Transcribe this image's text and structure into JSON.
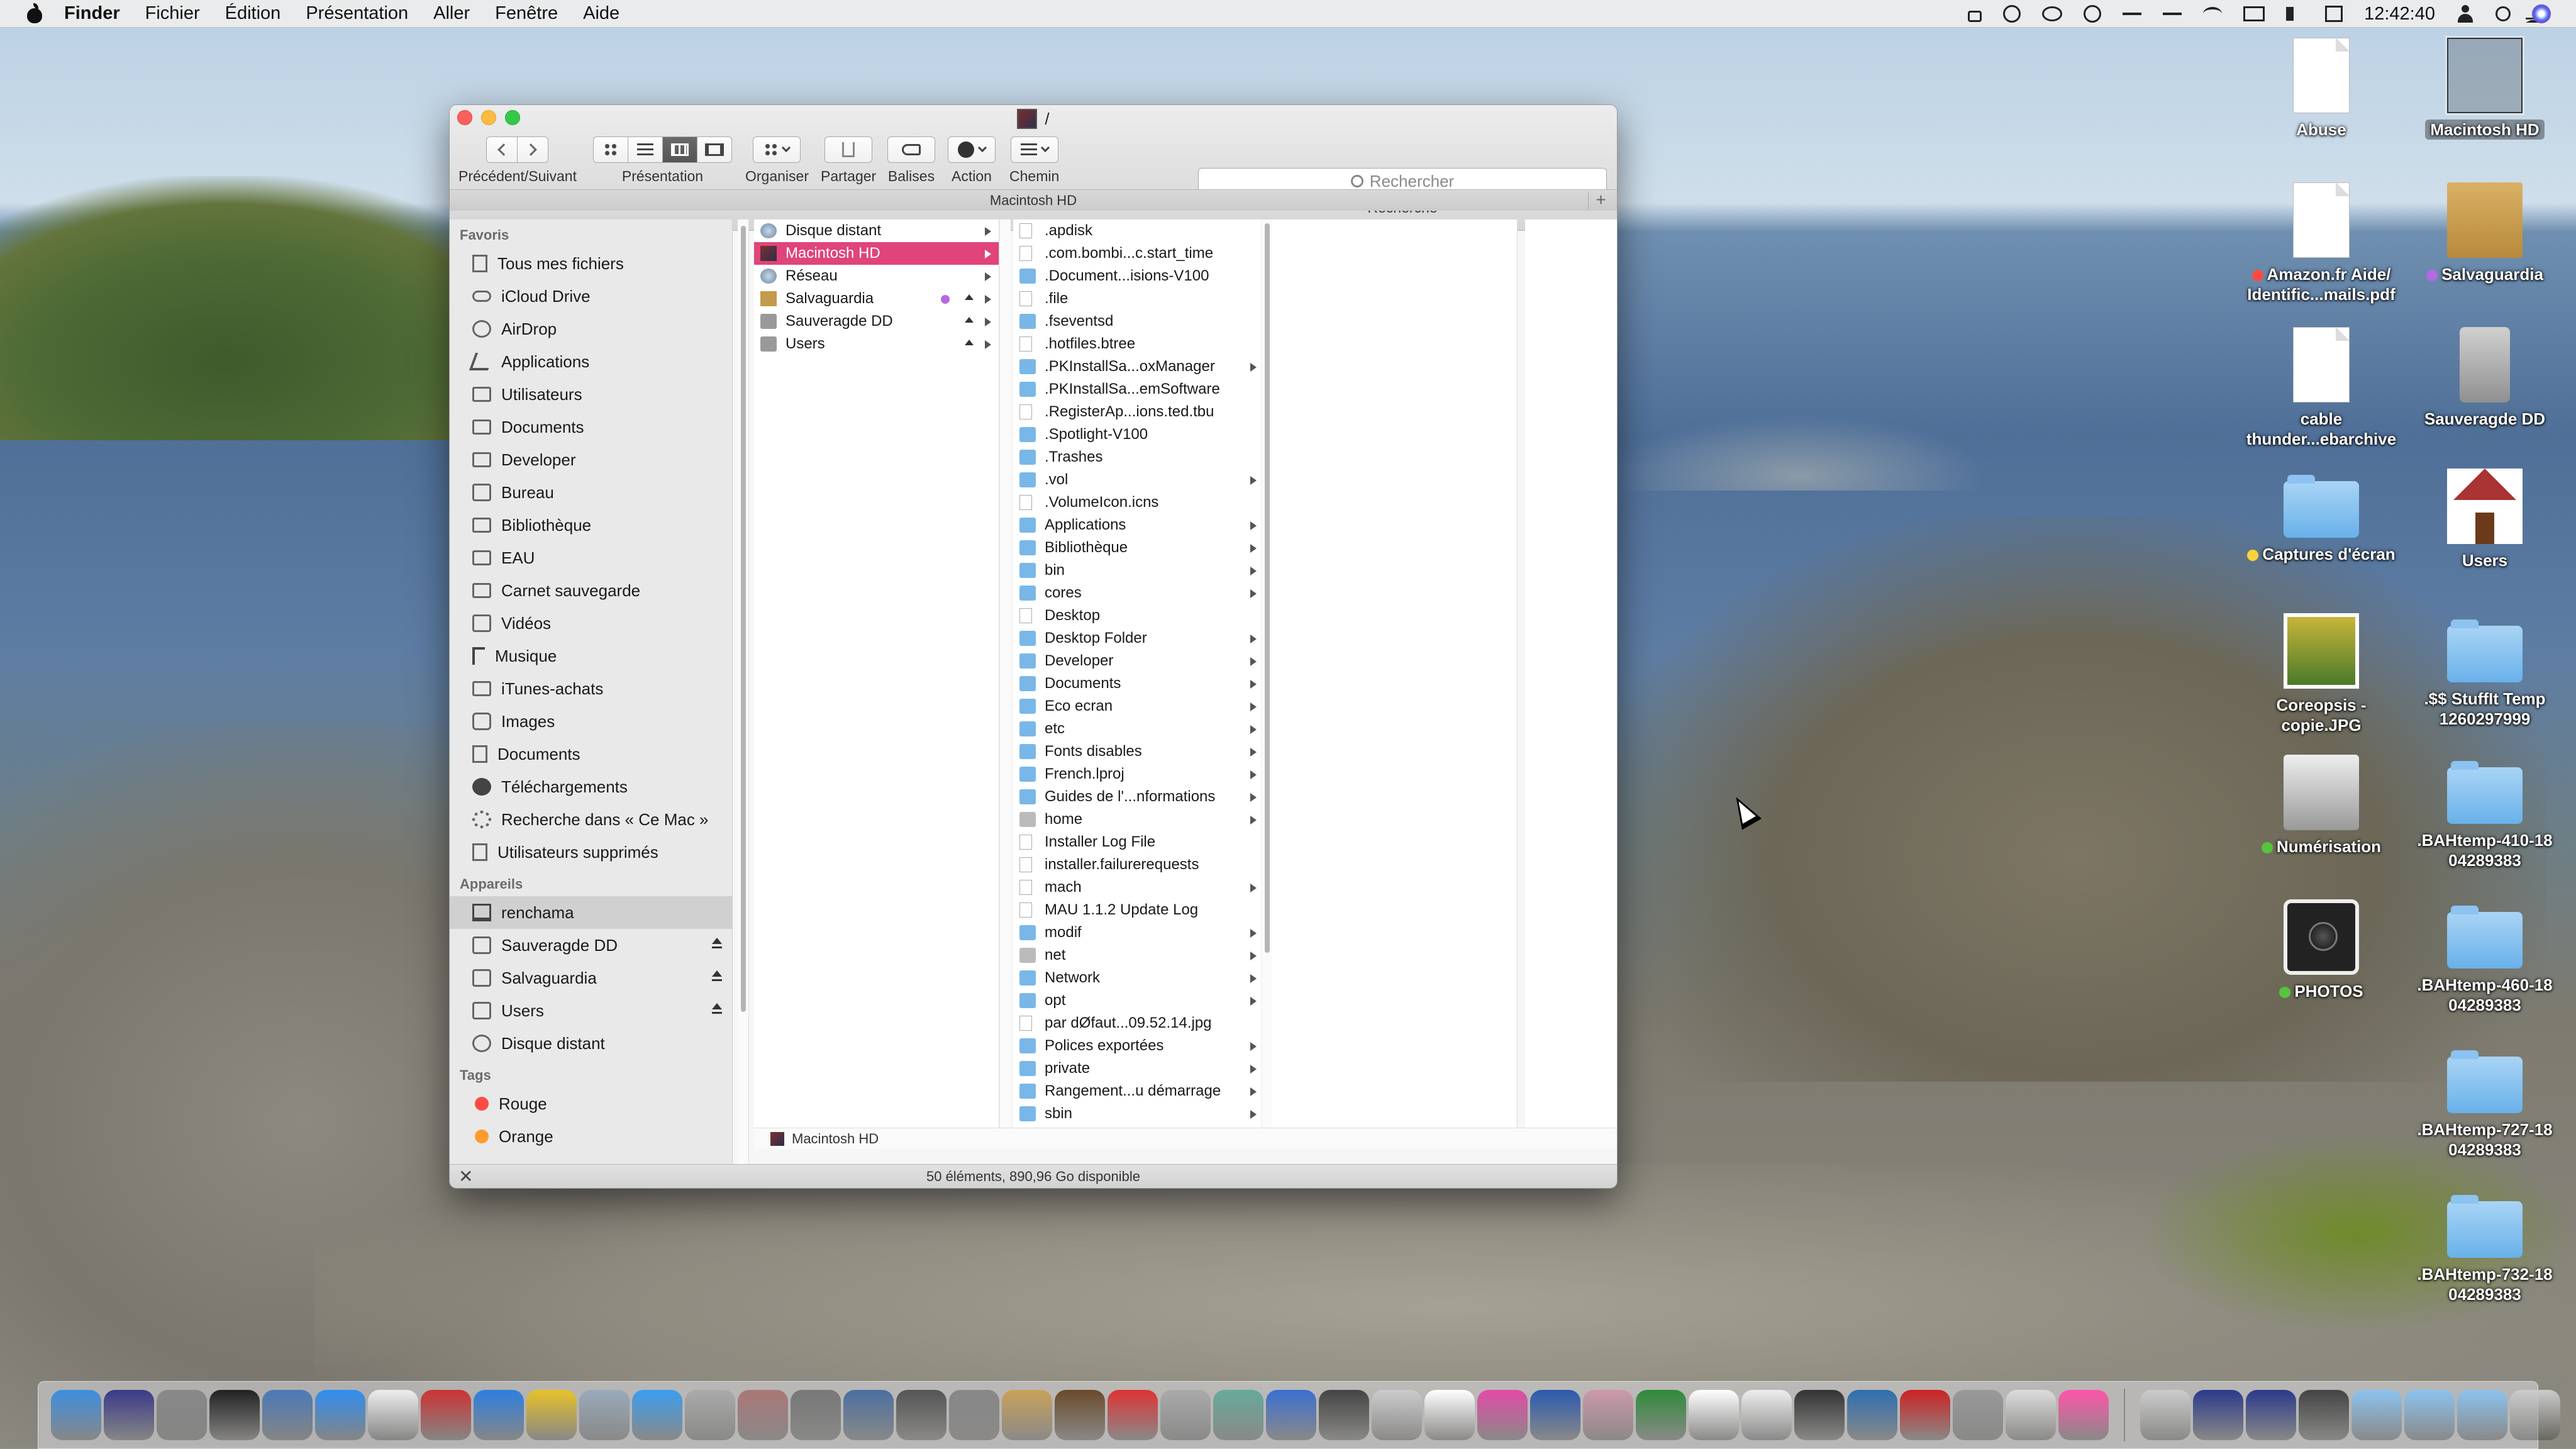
{
  "menubar": {
    "app_name": "Finder",
    "menus": [
      "Fichier",
      "Édition",
      "Présentation",
      "Aller",
      "Fenêtre",
      "Aide"
    ],
    "clock": "12:42:40"
  },
  "window": {
    "title": "/",
    "toolbar": {
      "nav_label": "Précédent/Suivant",
      "view_label": "Présentation",
      "arrange_label": "Organiser",
      "share_label": "Partager",
      "tags_label": "Balises",
      "action_label": "Action",
      "path_label": "Chemin",
      "search_placeholder": "Rechercher",
      "search_label": "Recherche"
    },
    "location_header": "Macintosh HD",
    "sidebar": {
      "favorites_heading": "Favoris",
      "favorites": [
        {
          "label": "Tous mes fichiers",
          "icon": "all-files-icon"
        },
        {
          "label": "iCloud Drive",
          "icon": "cloud-icon"
        },
        {
          "label": "AirDrop",
          "icon": "airdrop-icon"
        },
        {
          "label": "Applications",
          "icon": "applications-icon"
        },
        {
          "label": "Utilisateurs",
          "icon": "folder-icon"
        },
        {
          "label": "Documents",
          "icon": "folder-icon"
        },
        {
          "label": "Developer",
          "icon": "folder-icon"
        },
        {
          "label": "Bureau",
          "icon": "desktop-icon"
        },
        {
          "label": "Bibliothèque",
          "icon": "folder-icon"
        },
        {
          "label": "EAU",
          "icon": "folder-icon"
        },
        {
          "label": "Carnet sauvegarde",
          "icon": "folder-icon"
        },
        {
          "label": "Vidéos",
          "icon": "movies-icon"
        },
        {
          "label": "Musique",
          "icon": "music-icon"
        },
        {
          "label": "iTunes-achats",
          "icon": "folder-icon"
        },
        {
          "label": "Images",
          "icon": "camera-icon"
        },
        {
          "label": "Documents",
          "icon": "documents-icon"
        },
        {
          "label": "Téléchargements",
          "icon": "downloads-icon"
        },
        {
          "label": "Recherche dans « Ce Mac »",
          "icon": "gear-icon"
        },
        {
          "label": "Utilisateurs supprimés",
          "icon": "document-icon"
        }
      ],
      "devices_heading": "Appareils",
      "devices": [
        {
          "label": "renchama",
          "icon": "laptop-icon",
          "eject": false
        },
        {
          "label": "Sauveragde DD",
          "icon": "disk-icon",
          "eject": true
        },
        {
          "label": "Salvaguardia",
          "icon": "disk-icon",
          "eject": true
        },
        {
          "label": "Users",
          "icon": "disk-icon",
          "eject": true
        },
        {
          "label": "Disque distant",
          "icon": "remote-disk-icon",
          "eject": false
        }
      ],
      "tags_heading": "Tags",
      "tags": [
        {
          "label": "Rouge",
          "color": "#fd4b43"
        },
        {
          "label": "Orange",
          "color": "#fd9b2d"
        }
      ]
    },
    "column1": [
      {
        "label": "Disque distant",
        "icon": "remote-disk-icon"
      },
      {
        "label": "Macintosh HD",
        "icon": "hard-drive-icon"
      },
      {
        "label": "Réseau",
        "icon": "network-icon"
      },
      {
        "label": "Salvaguardia",
        "icon": "box-icon"
      },
      {
        "label": "Sauveragde DD",
        "icon": "drive-icon"
      },
      {
        "label": "Users",
        "icon": "drive-icon"
      }
    ],
    "column2": [
      {
        "label": ".apdisk",
        "kind": "doc",
        "arrow": false
      },
      {
        "label": ".com.bombi...c.start_time",
        "kind": "doc",
        "arrow": false
      },
      {
        "label": ".Document...isions-V100",
        "kind": "folder",
        "arrow": false
      },
      {
        "label": ".file",
        "kind": "doc",
        "arrow": false
      },
      {
        "label": ".fseventsd",
        "kind": "folder",
        "arrow": false
      },
      {
        "label": ".hotfiles.btree",
        "kind": "doc",
        "arrow": false
      },
      {
        "label": ".PKInstallSa...oxManager",
        "kind": "folder",
        "arrow": true
      },
      {
        "label": ".PKInstallSa...emSoftware",
        "kind": "folder",
        "arrow": false
      },
      {
        "label": ".RegisterAp...ions.ted.tbu",
        "kind": "doc",
        "arrow": false
      },
      {
        "label": ".Spotlight-V100",
        "kind": "folder",
        "arrow": false
      },
      {
        "label": ".Trashes",
        "kind": "folder",
        "arrow": false
      },
      {
        "label": ".vol",
        "kind": "folder",
        "arrow": true
      },
      {
        "label": ".VolumeIcon.icns",
        "kind": "doc",
        "arrow": false
      },
      {
        "label": "Applications",
        "kind": "folder",
        "arrow": true
      },
      {
        "label": "Bibliothèque",
        "kind": "folder",
        "arrow": true
      },
      {
        "label": "bin",
        "kind": "folder",
        "arrow": true
      },
      {
        "label": "cores",
        "kind": "folder",
        "arrow": true
      },
      {
        "label": "Desktop",
        "kind": "doc",
        "arrow": false
      },
      {
        "label": "Desktop Folder",
        "kind": "folder",
        "arrow": true
      },
      {
        "label": "Developer",
        "kind": "folder",
        "arrow": true
      },
      {
        "label": "Documents",
        "kind": "folder",
        "arrow": true
      },
      {
        "label": "Eco ecran",
        "kind": "folder",
        "arrow": true
      },
      {
        "label": "etc",
        "kind": "folder",
        "arrow": true
      },
      {
        "label": "Fonts disables",
        "kind": "folder",
        "arrow": true
      },
      {
        "label": "French.lproj",
        "kind": "folder",
        "arrow": true
      },
      {
        "label": "Guides de l'...nformations",
        "kind": "folder",
        "arrow": true
      },
      {
        "label": "home",
        "kind": "gray",
        "arrow": true
      },
      {
        "label": "Installer Log File",
        "kind": "doc",
        "arrow": false
      },
      {
        "label": "installer.failurerequests",
        "kind": "doc",
        "arrow": false
      },
      {
        "label": "mach",
        "kind": "doc",
        "arrow": true
      },
      {
        "label": "MAU 1.1.2 Update Log",
        "kind": "doc",
        "arrow": false
      },
      {
        "label": "modif",
        "kind": "folder",
        "arrow": true
      },
      {
        "label": "net",
        "kind": "gray",
        "arrow": true
      },
      {
        "label": "Network",
        "kind": "folder",
        "arrow": true
      },
      {
        "label": "opt",
        "kind": "folder",
        "arrow": true
      },
      {
        "label": "par dØfaut...09.52.14.jpg",
        "kind": "doc",
        "arrow": false
      },
      {
        "label": "Polices exportées",
        "kind": "folder",
        "arrow": true
      },
      {
        "label": "private",
        "kind": "folder",
        "arrow": true
      },
      {
        "label": "Rangement...u démarrage",
        "kind": "folder",
        "arrow": true
      },
      {
        "label": "sbin",
        "kind": "folder",
        "arrow": true
      }
    ],
    "path_bar": "Macintosh HD",
    "status": "50 éléments, 890,96 Go disponible"
  },
  "desktop": [
    {
      "label": "Abuse",
      "icon": "rtf-document-icon",
      "tag": ""
    },
    {
      "label": "Macintosh HD",
      "icon": "hard-drive-icon",
      "tag": ""
    },
    {
      "label": "Amazon.fr Aide/ Identific...mails.pdf",
      "icon": "pdf-document-icon",
      "tag": "#fd4b43"
    },
    {
      "label": "Salvaguardia",
      "icon": "box-icon",
      "tag": "#b469e0"
    },
    {
      "label": "cable thunder...ebarchive",
      "icon": "webarchive-icon",
      "tag": ""
    },
    {
      "label": "Sauveragde DD",
      "icon": "drive-icon",
      "tag": ""
    },
    {
      "label": "Captures d'écran",
      "icon": "folder-icon",
      "tag": "#fdd33a"
    },
    {
      "label": "Users",
      "icon": "home-icon",
      "tag": ""
    },
    {
      "label": "Coreopsis - copie.JPG",
      "icon": "photo-icon",
      "tag": ""
    },
    {
      "label": ".$$ StuffIt Temp 1260297999",
      "icon": "folder-icon",
      "tag": ""
    },
    {
      "label": "Numérisation",
      "icon": "scanner-icon",
      "tag": "#56c43c"
    },
    {
      "label": ".BAHtemp-410-18 04289383",
      "icon": "folder-icon",
      "tag": ""
    },
    {
      "label": "PHOTOS",
      "icon": "camera-icon",
      "tag": "#56c43c"
    },
    {
      "label": ".BAHtemp-460-18 04289383",
      "icon": "folder-icon",
      "tag": ""
    },
    {
      "label": ".BAHtemp-727-18 04289383",
      "icon": "folder-icon",
      "tag": ""
    },
    {
      "label": ".BAHtemp-732-18 04289383",
      "icon": "folder-icon",
      "tag": ""
    }
  ],
  "dock": [
    {
      "name": "finder-icon",
      "color": "#3d8fe0"
    },
    {
      "name": "siri-icon",
      "color": "#3a3a8a"
    },
    {
      "name": "launchpad-icon",
      "color": "#888"
    },
    {
      "name": "dashboard-icon",
      "color": "#222"
    },
    {
      "name": "mail-stamp-icon",
      "color": "#4a7ab8"
    },
    {
      "name": "app-store-icon",
      "color": "#2f8ef0"
    },
    {
      "name": "notes-icon",
      "color": "#eee"
    },
    {
      "name": "photo-booth-icon",
      "color": "#c33"
    },
    {
      "name": "safari-icon",
      "color": "#2d7fe0"
    },
    {
      "name": "chrome-icon",
      "color": "#e8c22a"
    },
    {
      "name": "preview-icon",
      "color": "#9ab"
    },
    {
      "name": "messages-icon",
      "color": "#3a9ef0"
    },
    {
      "name": "magnifier-icon",
      "color": "#aaa"
    },
    {
      "name": "notebook-icon",
      "color": "#a77"
    },
    {
      "name": "system-preferences-icon",
      "color": "#777"
    },
    {
      "name": "network-utility-icon",
      "color": "#4a6fa0"
    },
    {
      "name": "grapher-icon",
      "color": "#555"
    },
    {
      "name": "utility-icon",
      "color": "#888"
    },
    {
      "name": "archive-icon",
      "color": "#c9a25a"
    },
    {
      "name": "unarchiver-icon",
      "color": "#6a4a2a"
    },
    {
      "name": "calendar-app-icon",
      "color": "#d33"
    },
    {
      "name": "disk-utility-icon",
      "color": "#aaa"
    },
    {
      "name": "contacts-icon",
      "color": "#6a9"
    },
    {
      "name": "globe-icon",
      "color": "#3a6fd0"
    },
    {
      "name": "webcam-icon",
      "color": "#444"
    },
    {
      "name": "plane-icon",
      "color": "#ccc"
    },
    {
      "name": "calendar-icon",
      "color": "#fff"
    },
    {
      "name": "itunes-icon",
      "color": "#e24aa7"
    },
    {
      "name": "word-icon",
      "color": "#2a5ab0"
    },
    {
      "name": "tools-icon",
      "color": "#c9a"
    },
    {
      "name": "excel-icon",
      "color": "#2e8b3a"
    },
    {
      "name": "solitaire-icon",
      "color": "#fff"
    },
    {
      "name": "cards-icon",
      "color": "#eee"
    },
    {
      "name": "wifi-tool-icon",
      "color": "#333"
    },
    {
      "name": "bittorrent-icon",
      "color": "#2d6fb0"
    },
    {
      "name": "pdf-app-icon",
      "color": "#c22"
    },
    {
      "name": "utilities-icon",
      "color": "#999"
    },
    {
      "name": "pdf-pen-icon",
      "color": "#ddd"
    },
    {
      "name": "photos-icon",
      "color": "#f5a"
    },
    {
      "name": "itunes-doc-icon",
      "color": "#ccc"
    },
    {
      "name": "stack-a-icon",
      "color": "#2a3a8a"
    },
    {
      "name": "stack-b-icon",
      "color": "#2a3a8a"
    },
    {
      "name": "control-icon",
      "color": "#444"
    },
    {
      "name": "folder-stack-icon",
      "color": "#8cc3f0"
    },
    {
      "name": "downloads-stack-icon",
      "color": "#8cc3f0"
    },
    {
      "name": "documents-stack-icon",
      "color": "#8cc3f0"
    },
    {
      "name": "trash-icon",
      "color": "#ccc"
    }
  ]
}
